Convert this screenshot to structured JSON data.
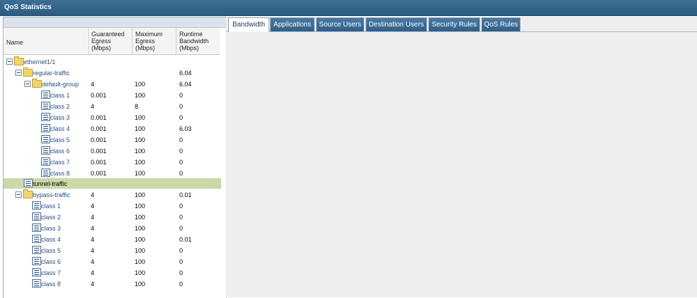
{
  "window": {
    "title": "QoS Statistics"
  },
  "columns": [
    "Name",
    "Guaranteed\nEgress\n(Mbps)",
    "Maximum\nEgress\n(Mbps)",
    "Runtime\nBandwidth\n(Mbps)"
  ],
  "tabs": [
    "Bandwidth",
    "Applications",
    "Source Users",
    "Destination Users",
    "Security Rules",
    "QoS Rules"
  ],
  "active_tab": "Bandwidth",
  "tree": [
    {
      "name": "ethernet1/1",
      "guaranteed": "",
      "maximum": "",
      "runtime": ""
    },
    {
      "name": "regular-traffic",
      "guaranteed": "",
      "maximum": "",
      "runtime": "6.04"
    },
    {
      "name": "default-group",
      "guaranteed": "4",
      "maximum": "100",
      "runtime": "6.04"
    },
    {
      "name": "class 1",
      "guaranteed": "0.001",
      "maximum": "100",
      "runtime": "0"
    },
    {
      "name": "class 2",
      "guaranteed": "4",
      "maximum": "8",
      "runtime": "0"
    },
    {
      "name": "class 3",
      "guaranteed": "0.001",
      "maximum": "100",
      "runtime": "0"
    },
    {
      "name": "class 4",
      "guaranteed": "0.001",
      "maximum": "100",
      "runtime": "6.03"
    },
    {
      "name": "class 5",
      "guaranteed": "0.001",
      "maximum": "100",
      "runtime": "0"
    },
    {
      "name": "class 6",
      "guaranteed": "0.001",
      "maximum": "100",
      "runtime": "0"
    },
    {
      "name": "class 7",
      "guaranteed": "0.001",
      "maximum": "100",
      "runtime": "0"
    },
    {
      "name": "class 8",
      "guaranteed": "0.001",
      "maximum": "100",
      "runtime": "0"
    },
    {
      "name": "tunnel-traffic",
      "guaranteed": "",
      "maximum": "",
      "runtime": ""
    },
    {
      "name": "bypass-traffic",
      "guaranteed": "4",
      "maximum": "100",
      "runtime": "0.01"
    },
    {
      "name": "class 1",
      "guaranteed": "4",
      "maximum": "100",
      "runtime": "0"
    },
    {
      "name": "class 2",
      "guaranteed": "4",
      "maximum": "100",
      "runtime": "0"
    },
    {
      "name": "class 3",
      "guaranteed": "4",
      "maximum": "100",
      "runtime": "0"
    },
    {
      "name": "class 4",
      "guaranteed": "4",
      "maximum": "100",
      "runtime": "0.01"
    },
    {
      "name": "class 5",
      "guaranteed": "4",
      "maximum": "100",
      "runtime": "0"
    },
    {
      "name": "class 6",
      "guaranteed": "4",
      "maximum": "100",
      "runtime": "0"
    },
    {
      "name": "class 7",
      "guaranteed": "4",
      "maximum": "100",
      "runtime": "0"
    },
    {
      "name": "class 8",
      "guaranteed": "4",
      "maximum": "100",
      "runtime": "0"
    }
  ],
  "selected_row": "tunnel-traffic",
  "colors": {
    "titlebar": "#2f5f88",
    "selected_row": "#cad9a6",
    "tab": "#3d6d96"
  }
}
